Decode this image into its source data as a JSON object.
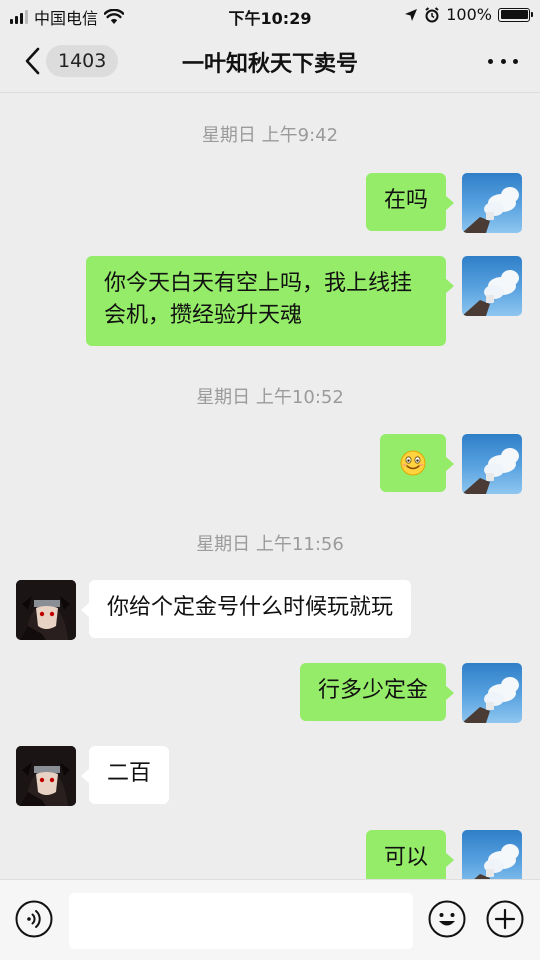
{
  "status_bar": {
    "carrier": "中国电信",
    "time": "下午10:29",
    "battery": "100%"
  },
  "header": {
    "back_icon": "chevron-left-icon",
    "unread_count": "1403",
    "title": "一叶知秋天下卖号",
    "more_icon": "more-dots-icon"
  },
  "messages": [
    {
      "type": "timestamp",
      "text": "星期日 上午9:42"
    },
    {
      "type": "message",
      "sender": "self",
      "text": "在吗"
    },
    {
      "type": "message",
      "sender": "self",
      "text": "你今天白天有空上吗，我上线挂会机，攒经验升天魂"
    },
    {
      "type": "timestamp",
      "text": "星期日 上午10:52"
    },
    {
      "type": "message",
      "sender": "self",
      "content": "emoji",
      "icon": "smiley-emoji-icon"
    },
    {
      "type": "timestamp",
      "text": "星期日 上午11:56"
    },
    {
      "type": "message",
      "sender": "other",
      "text": "你给个定金号什么时候玩就玩"
    },
    {
      "type": "message",
      "sender": "self",
      "text": "行多少定金"
    },
    {
      "type": "message",
      "sender": "other",
      "text": "二百"
    },
    {
      "type": "message",
      "sender": "self",
      "text": "可以"
    }
  ],
  "input_bar": {
    "voice_icon": "voice-icon",
    "input_value": "",
    "emoji_icon": "emoji-face-icon",
    "plus_icon": "plus-circle-icon"
  },
  "colors": {
    "background": "#ededed",
    "self_bubble": "#95ec69",
    "other_bubble": "#ffffff",
    "timestamp_text": "#9b9b9b"
  }
}
